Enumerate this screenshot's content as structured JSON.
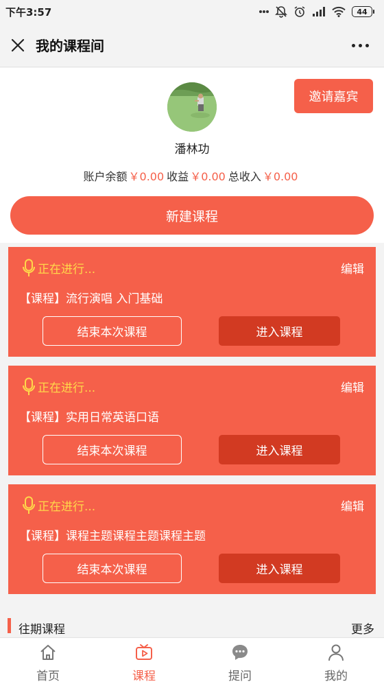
{
  "status_bar": {
    "time": "下午3:57",
    "battery": "44"
  },
  "header": {
    "title": "我的课程间"
  },
  "profile": {
    "invite_label": "邀请嘉宾",
    "name": "潘林功",
    "balance_label": "账户余额",
    "balance_value": "￥0.00",
    "income_label": "收益",
    "income_value": "￥0.00",
    "total_label": "总收入",
    "total_value": "￥0.00",
    "new_course_label": "新建课程"
  },
  "courses": [
    {
      "status": "正在进行...",
      "edit": "编辑",
      "title": "【课程】流行演唱 入门基础",
      "end_label": "结束本次课程",
      "enter_label": "进入课程"
    },
    {
      "status": "正在进行...",
      "edit": "编辑",
      "title": "【课程】实用日常英语口语",
      "end_label": "结束本次课程",
      "enter_label": "进入课程"
    },
    {
      "status": "正在进行...",
      "edit": "编辑",
      "title": "【课程】课程主题课程主题课程主题",
      "end_label": "结束本次课程",
      "enter_label": "进入课程"
    }
  ],
  "past_section": {
    "label": "往期课程",
    "more": "更多"
  },
  "tabbar": {
    "items": [
      {
        "label": "首页",
        "icon": "home-icon"
      },
      {
        "label": "课程",
        "icon": "tv-play-icon"
      },
      {
        "label": "提问",
        "icon": "chat-bubble-icon"
      },
      {
        "label": "我的",
        "icon": "person-icon"
      }
    ],
    "active_index": 1
  },
  "colors": {
    "accent": "#f5604a",
    "enter_button": "#d23a22",
    "status_text": "#ffd84a"
  }
}
